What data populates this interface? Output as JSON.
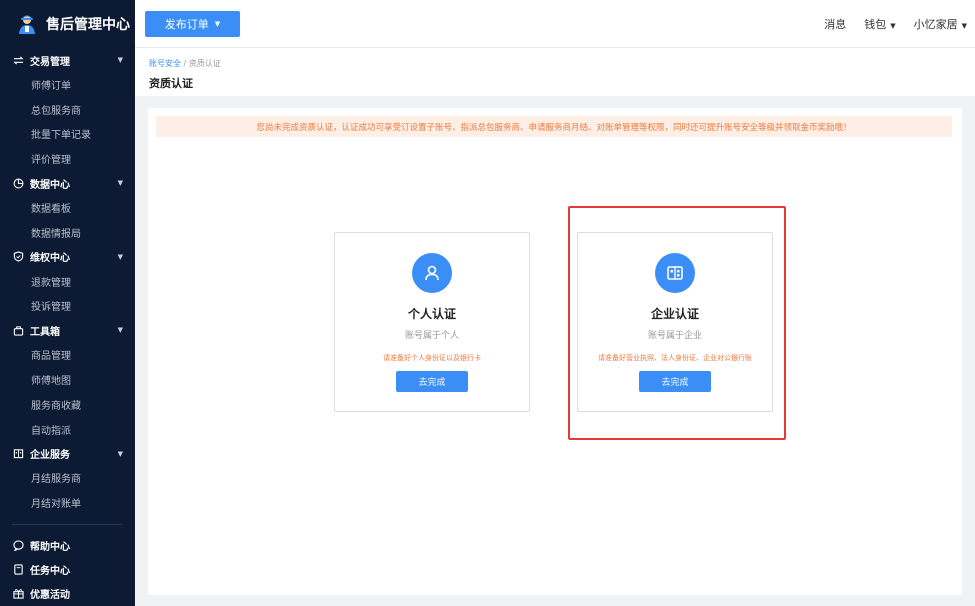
{
  "app": {
    "title": "售后管理中心"
  },
  "sidebar": {
    "groups": [
      {
        "label": "交易管理",
        "icon": "swap-icon",
        "items": [
          "师傅订单",
          "总包服务商",
          "批量下单记录",
          "评价管理"
        ]
      },
      {
        "label": "数据中心",
        "icon": "pie-chart-icon",
        "items": [
          "数据看板",
          "数据情报局"
        ]
      },
      {
        "label": "维权中心",
        "icon": "shield-icon",
        "items": [
          "退款管理",
          "投诉管理"
        ]
      },
      {
        "label": "工具箱",
        "icon": "toolbox-icon",
        "items": [
          "商品管理",
          "师傅地图",
          "服务商收藏",
          "自动指派"
        ]
      },
      {
        "label": "企业服务",
        "icon": "building-icon",
        "items": [
          "月结服务商",
          "月结对账单"
        ]
      }
    ],
    "bottom": [
      {
        "label": "帮助中心",
        "icon": "help-chat-icon"
      },
      {
        "label": "任务中心",
        "icon": "task-icon"
      },
      {
        "label": "优惠活动",
        "icon": "gift-icon"
      }
    ]
  },
  "topbar": {
    "publish_label": "发布订单",
    "messages": "消息",
    "wallet": "钱包",
    "user": "小忆家居"
  },
  "breadcrumb": {
    "parent": "账号安全",
    "separator": "/",
    "current": "资质认证"
  },
  "page": {
    "title": "资质认证"
  },
  "notice": "您尚未完成资质认证，认证成功可享受订设置子账号、指派总包服务商、申请服务商月结、对账单管理等权限，同时还可提升账号安全等级并领取金币奖励哦！",
  "cards": {
    "personal": {
      "title": "个人认证",
      "subtitle": "账号属于个人",
      "tip": "请准备好个人身份证以及银行卡",
      "button": "去完成",
      "icon": "user-icon"
    },
    "company": {
      "title": "企业认证",
      "subtitle": "账号属于企业",
      "tip": "请准备好营业执照、法人身份证、企业对公银行账",
      "button": "去完成",
      "icon": "building-card-icon"
    }
  },
  "colors": {
    "primary": "#3a8ef6",
    "sidebar_bg": "#0c1a33",
    "notice_text": "#f07b3f",
    "notice_bg": "#fdeee6",
    "highlight": "#e53935"
  }
}
